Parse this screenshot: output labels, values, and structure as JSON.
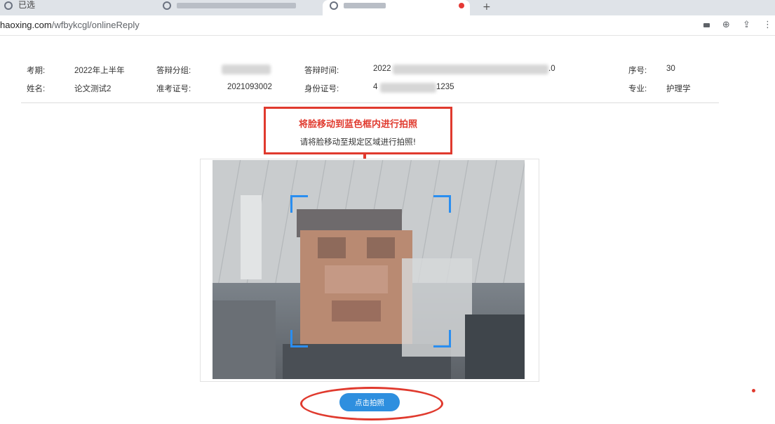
{
  "browser": {
    "tabs": [
      {
        "label": "已选",
        "active": false
      },
      {
        "label": "",
        "active": false
      },
      {
        "label": "",
        "active": true
      },
      {
        "label": "",
        "active": false
      }
    ],
    "new_tab": "+",
    "url_prefix": "haoxing.com",
    "url_path": "/wfbykcgl/onlineReply",
    "toolbar_icons": [
      "camera-icon",
      "zoom-icon",
      "share-icon"
    ]
  },
  "info": {
    "term_label": "考期:",
    "term_value": "2022年上半年",
    "group_label": "答辩分组:",
    "group_value": "",
    "time_label": "答辩时间:",
    "time_value_start": "2022",
    "time_value_end": ".0",
    "seq_label": "序号:",
    "seq_value": "30",
    "name_label": "姓名:",
    "name_value": "论文测试2",
    "admission_label": "准考证号:",
    "admission_value": "2021093002",
    "id_label": "身份证号:",
    "id_value_start": "4",
    "id_value_end": "1235",
    "major_label": "专业:",
    "major_value": "护理学"
  },
  "annotation": {
    "title": "将脸移动到蓝色框内进行拍照",
    "subtitle": "请将脸移动至规定区域进行拍照!"
  },
  "camera": {
    "frame_color": "#2a8ef0"
  },
  "capture_button": {
    "label": "点击拍照"
  },
  "colors": {
    "annotation_red": "#e03a2e",
    "button_blue": "#2e8fdf"
  }
}
